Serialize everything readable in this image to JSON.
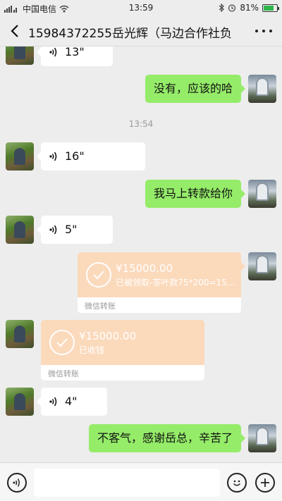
{
  "status": {
    "carrier": "中国电信",
    "time": "13:59",
    "battery": "81%",
    "battery_level": 0.81
  },
  "header": {
    "title": "15984372255岳光辉（马边合作社负"
  },
  "messages": {
    "m1": {
      "duration": "13\""
    },
    "m2": {
      "text": "没有，应该的哈"
    },
    "ts1": {
      "text": "13:54"
    },
    "m3": {
      "duration": "16\""
    },
    "m4": {
      "text": "我马上转款给你"
    },
    "m5": {
      "duration": "5\""
    },
    "t1": {
      "amount": "¥15000.00",
      "desc": "已被领取-茶叶款75*200=15...",
      "footer": "微信转账"
    },
    "t2": {
      "amount": "¥15000.00",
      "desc": "已收钱",
      "footer": "微信转账"
    },
    "m6": {
      "duration": "4\""
    },
    "m7": {
      "text": "不客气，感谢岳总，辛苦了"
    }
  },
  "input": {
    "value": "",
    "placeholder": ""
  },
  "colors": {
    "bubble_sent": "#95ec69",
    "bubble_received": "#ffffff",
    "transfer": "#fbd9bb",
    "background": "#ededed"
  },
  "icons": {
    "back": "chevron-left-icon",
    "more": "more-dots-icon",
    "voice": "voice-icon",
    "emoji": "emoji-icon",
    "add": "plus-icon"
  }
}
